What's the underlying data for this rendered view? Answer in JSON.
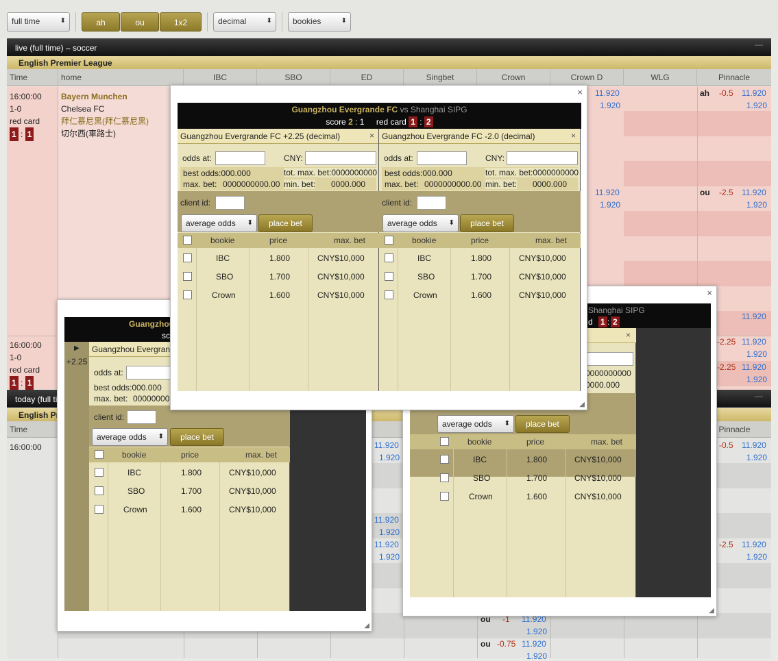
{
  "toolbar": {
    "period_select": "full time",
    "btn_ah": "ah",
    "btn_ou": "ou",
    "btn_1x2": "1x2",
    "odds_select": "decimal",
    "bookies_select": "bookies"
  },
  "live_panel": {
    "title": "live (full time) – soccer",
    "minimize": "—",
    "league": "English Premier League",
    "columns": [
      "Time",
      "home",
      "IBC",
      "SBO",
      "ED",
      "Singbet",
      "Crown",
      "Crown D",
      "WLG",
      "Pinnacle"
    ],
    "match1": {
      "time": "16:00:00",
      "score": "1-0",
      "red_card_label": "red card",
      "rc_home": "1",
      "rc_sep": ":",
      "rc_away": "1",
      "home": "Bayern Munchen",
      "away": "Chelsea FC",
      "home_cn": "拜仁慕尼黑(拜仁慕尼黑)",
      "away_cn": "切尔西(車路士)"
    },
    "match2": {
      "time": "16:00:00",
      "score": "1-0",
      "red_card_label": "red card",
      "rc_home": "1",
      "rc_sep": ":",
      "rc_away": "1"
    }
  },
  "today_panel": {
    "title": "today (full ti",
    "minimize": "—",
    "league": "English Prem",
    "col_time": "Time",
    "col_pinnacle": "Pinnacle",
    "time": "16:00:00"
  },
  "odds": {
    "crownd_a": "11.920",
    "crownd_b": "1.920",
    "crownd_c": "11.920",
    "crownd_d": "1.920",
    "pin_ah_label": "ah",
    "pin_ah_line": "-0.5",
    "pin_ah_a": "11.920",
    "pin_ah_b": "1.920",
    "pin_ou_label": "ou",
    "pin_ou_line": "-2.5",
    "pin_ou_a": "11.920",
    "pin_ou_b": "1.920",
    "pin_r3": "11.920",
    "pin_r4_line": "-2.25",
    "pin_r4_a": "11.920",
    "pin_r4_b": "1.920",
    "pin_r5_line": "-2.25",
    "pin_r5_a": "11.920",
    "pin_r5_b": "1.920",
    "pin_t1_line": "-0.5",
    "pin_t1_a": "11.920",
    "pin_t1_b": "1.920",
    "pin_t2_line": "-2.5",
    "pin_t2_a": "11.920",
    "pin_t2_b": "1.920",
    "left_a": "11.920",
    "left_b": "1.920",
    "left_c": "11.920",
    "left_d": "1.920",
    "left_e": "11.920",
    "left_f": "1.920",
    "bot_ou1_label": "ou",
    "bot_ou1_line": "-1",
    "bot_ou1_a": "11.920",
    "bot_ou1_b": "1.920",
    "bot_ou2_label": "ou",
    "bot_ou2_line": "-0.75",
    "bot_ou2_a": "11.920",
    "bot_ou2_b": "1.920"
  },
  "popup_main": {
    "home": "Guangzhou Evergrande FC",
    "vs": "vs",
    "away": "Shanghai SIPG",
    "score_label": "score",
    "score_home": "2",
    "score_sep": ":",
    "score_away": "1",
    "red_card_label": "red card",
    "rc_home": "1",
    "rc_sep": ":",
    "rc_away": "2",
    "close": "×",
    "slips": [
      {
        "title": "Guangzhou Evergrande FC +2.25 (decimal)",
        "close": "×",
        "odds_at": "odds at:",
        "cny": "CNY:",
        "best_odds": "best odds:000.000",
        "tot_max_bet": "tot. max. bet:0000000000",
        "max_bet": "max. bet:",
        "max_bet_val": "0000000000.00",
        "min_bet": "min. bet:",
        "min_bet_val": "0000.000",
        "client_id": "client id:",
        "avg_select": "average odds",
        "place_bet": "place bet",
        "col_bookie": "bookie",
        "col_price": "price",
        "col_max": "max. bet",
        "rows": [
          {
            "bookie": "IBC",
            "price": "1.800",
            "max": "CNY$10,000"
          },
          {
            "bookie": "SBO",
            "price": "1.700",
            "max": "CNY$10,000"
          },
          {
            "bookie": "Crown",
            "price": "1.600",
            "max": "CNY$10,000"
          }
        ]
      },
      {
        "title": "Guangzhou Evergrande FC -2.0 (decimal)",
        "close": "×",
        "odds_at": "odds at:",
        "cny": "CNY:",
        "best_odds": "best odds:000.000",
        "tot_max_bet": "tot. max. bet:0000000000",
        "max_bet": "max. bet:",
        "max_bet_val": "0000000000.00",
        "min_bet": "min. bet:",
        "min_bet_val": "0000.000",
        "client_id": "client id:",
        "avg_select": "average odds",
        "place_bet": "place bet",
        "col_bookie": "bookie",
        "col_price": "price",
        "col_max": "max. bet",
        "rows": [
          {
            "bookie": "IBC",
            "price": "1.800",
            "max": "CNY$10,000"
          },
          {
            "bookie": "SBO",
            "price": "1.700",
            "max": "CNY$10,000"
          },
          {
            "bookie": "Crown",
            "price": "1.600",
            "max": "CNY$10,000"
          }
        ]
      }
    ]
  },
  "popup_left": {
    "title_frag": "Guangzhou",
    "score_frag": "sc",
    "arrow": "▶",
    "line": "+2.25",
    "slip_title": "Guangzhou Evergrand",
    "odds_at": "odds at:",
    "best_odds": "best odds:000.000",
    "max_bet": "max. bet:",
    "max_bet_val": "00000000",
    "client_id": "client id:",
    "avg_select": "average odds",
    "place_bet": "place bet",
    "col_bookie": "bookie",
    "col_price": "price",
    "col_max": "max. bet",
    "rows": [
      {
        "bookie": "IBC",
        "price": "1.800",
        "max": "CNY$10,000"
      },
      {
        "bookie": "SBO",
        "price": "1.700",
        "max": "CNY$10,000"
      },
      {
        "bookie": "Crown",
        "price": "1.600",
        "max": "CNY$10,000"
      }
    ]
  },
  "popup_right": {
    "close": "×",
    "title_frag": "Shanghai SIPG",
    "rc_frag": "d",
    "rc_home": "1",
    "rc_sep": ":",
    "rc_away": "2",
    "slip_title_frag": ")",
    "slip_close": "×",
    "tot_frag": "0000000000",
    "min_frag": "0000.000",
    "avg_select": "average odds",
    "place_bet": "place bet",
    "col_bookie": "bookie",
    "col_price": "price",
    "col_max": "max. bet",
    "rows": [
      {
        "bookie": "IBC",
        "price": "1.800",
        "max": "CNY$10,000"
      },
      {
        "bookie": "SBO",
        "price": "1.700",
        "max": "CNY$10,000"
      },
      {
        "bookie": "Crown",
        "price": "1.600",
        "max": "CNY$10,000"
      }
    ]
  }
}
